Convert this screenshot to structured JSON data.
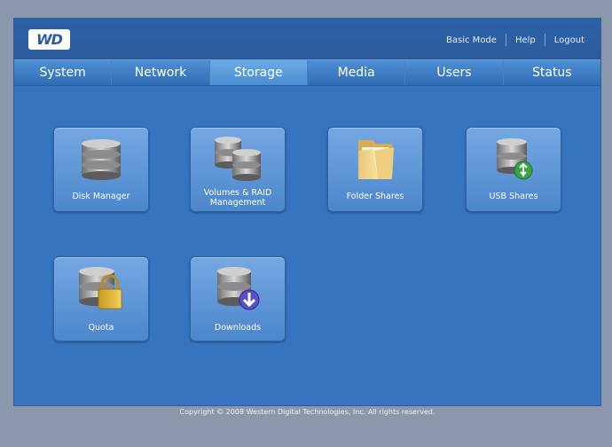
{
  "brand": {
    "logo_text": "WD"
  },
  "header": {
    "links": [
      "Basic Mode",
      "Help",
      "Logout"
    ]
  },
  "tabs": [
    {
      "label": "System"
    },
    {
      "label": "Network"
    },
    {
      "label": "Storage",
      "active": true
    },
    {
      "label": "Media"
    },
    {
      "label": "Users"
    },
    {
      "label": "Status"
    }
  ],
  "tiles": [
    {
      "label": "Disk Manager",
      "icon": "disk-stack-icon"
    },
    {
      "label": "Volumes & RAID Management",
      "icon": "double-disk-stack-icon"
    },
    {
      "label": "Folder Shares",
      "icon": "folder-icon"
    },
    {
      "label": "USB Shares",
      "icon": "usb-disk-icon"
    },
    {
      "label": "Quota",
      "icon": "padlock-disk-icon"
    },
    {
      "label": "Downloads",
      "icon": "download-disk-icon"
    }
  ],
  "footer": {
    "copyright": "Copyright © 2008 Western Digital Technologies, Inc. All rights reserved."
  },
  "colors": {
    "background": "#3674bf",
    "header": "#2a5b9c",
    "tab_active": "#5a9fe0",
    "tile": "#5f97d8"
  }
}
